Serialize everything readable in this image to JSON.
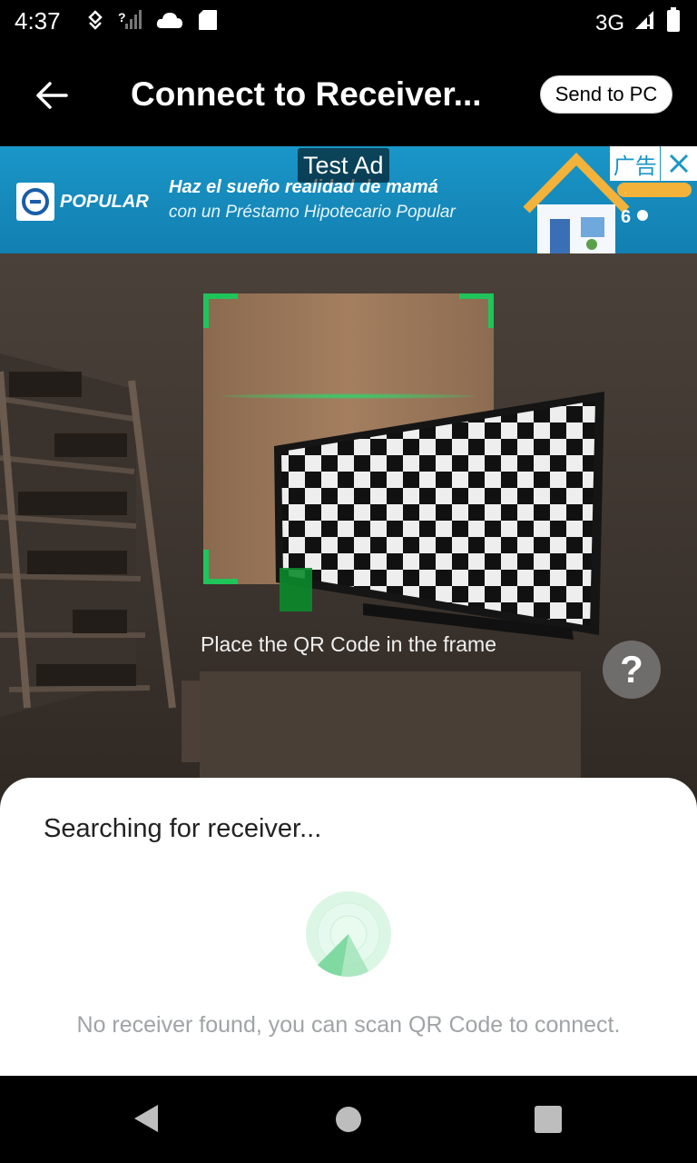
{
  "status_bar": {
    "time": "4:37",
    "network": "3G",
    "icons": [
      "location-icon",
      "no-signal-icon",
      "cloud-icon",
      "sd-card-icon",
      "signal-icon",
      "battery-icon"
    ]
  },
  "app_bar": {
    "title": "Connect to Receiver...",
    "send_to_pc_label": "Send to PC"
  },
  "ad": {
    "test_label": "Test Ad",
    "close_label": "广告",
    "brand": "POPULAR",
    "line1": "Haz el sueño realidad de mamá",
    "line2": "con un Préstamo Hipotecario Popular"
  },
  "scanner": {
    "hint": "Place the QR Code in the frame",
    "help_label": "?",
    "frame_color": "#1fc55a"
  },
  "sheet": {
    "title": "Searching for receiver...",
    "message": "No receiver found, you can scan QR Code to connect."
  },
  "colors": {
    "accent": "#1fc55a",
    "ad_bg": "#1a96c8"
  }
}
